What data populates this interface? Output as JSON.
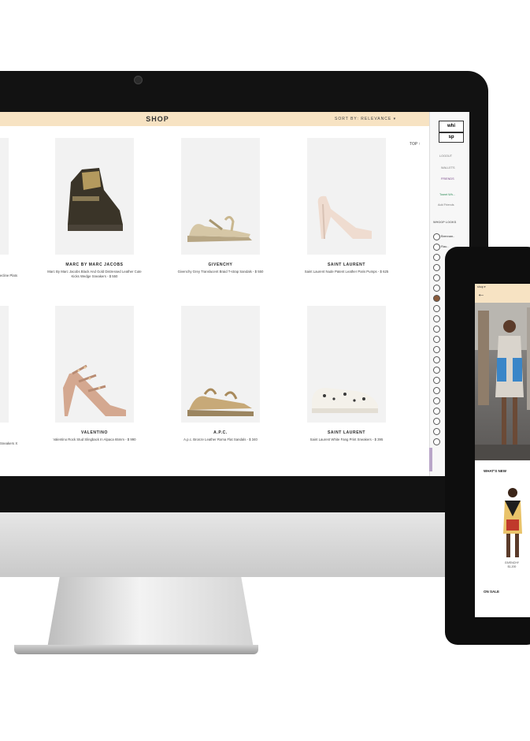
{
  "shop": {
    "title": "SHOP",
    "sort_label": "SORT BY: RELEVANCE ▾",
    "top_link": "TOP ↑",
    "left_cut_texts": [
      "ecline Plats",
      "Sneakers X"
    ],
    "products": [
      {
        "brand": "MARC BY MARC JACOBS",
        "description": "Marc By Marc Jacobs Black And Gold Distressed Leather Cute Kicks Wedge Sneakers - $ 550"
      },
      {
        "brand": "GIVENCHY",
        "description": "Givenchy Grey Translucent Braid T-strap Sandals - $ 550"
      },
      {
        "brand": "SAINT LAURENT",
        "description": "Saint Laurent Nude Patent Leather Paris Pumps - $ 625"
      },
      {
        "brand": "VALENTINO",
        "description": "Valentino Rock Stud Slingback In Alpaca 65mm - $ 990"
      },
      {
        "brand": "A.P.C.",
        "description": "A.p.c. Bronze Leather Roma Flat Sandals - $ 340"
      },
      {
        "brand": "SAINT LAURENT",
        "description": "Saint Laurent White Fang Print Sneakers - $ 395"
      }
    ]
  },
  "sidebar": {
    "logo_line1": "whi",
    "logo_line2": "sp",
    "logout": "LOGOUT",
    "wallet": "WALLETS",
    "friends": "FRIENDS",
    "tagline": "Tweet Wh...",
    "add_friends": "Add Friends",
    "section": "WHOOP LOOKS",
    "items": [
      "Brennan..",
      "Rau..",
      "",
      "",
      "",
      "",
      "",
      "",
      "",
      "",
      "",
      "",
      "",
      "",
      "",
      ""
    ]
  },
  "tablet": {
    "bar_title": "shop ▾",
    "back_arrow": "←",
    "whats_new": "WHAT'S NEW",
    "item_brand": "GIVENCHY",
    "item_price": "$1,200",
    "on_sale": "ON SALE"
  },
  "colors": {
    "header_bg": "#f7e3c3",
    "bezel": "#121212",
    "accent_purple": "#7a4a8a"
  },
  "icons": {
    "back": "arrow-left-icon",
    "sort": "chevron-down-icon",
    "top": "arrow-up-icon",
    "avatar": "circle-avatar-icon"
  }
}
